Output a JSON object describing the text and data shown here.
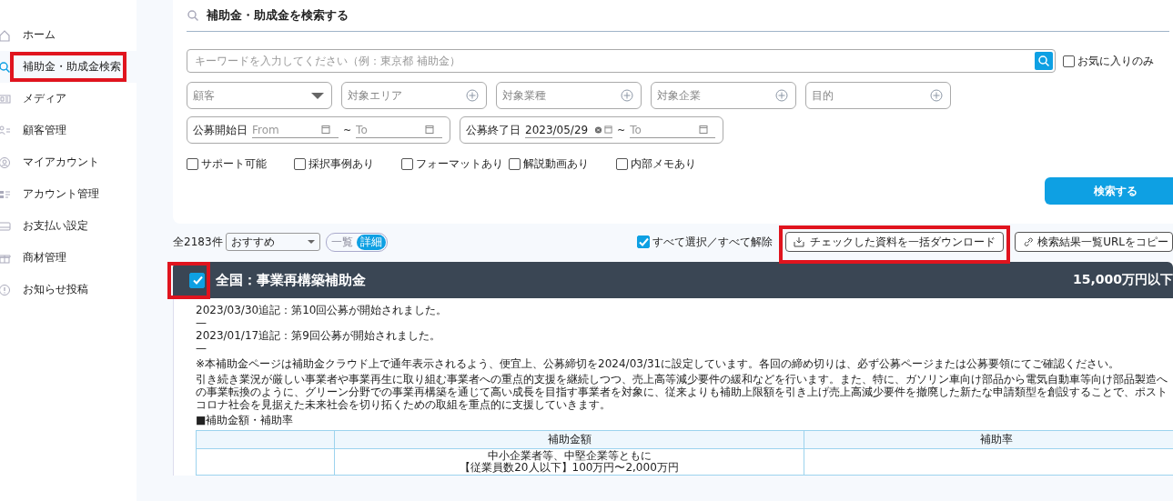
{
  "sidebar": {
    "items": [
      {
        "label": "ホーム",
        "selected": false
      },
      {
        "label": "補助金・助成金検索",
        "selected": true
      },
      {
        "label": "メディア",
        "selected": false
      },
      {
        "label": "顧客管理",
        "selected": false
      },
      {
        "label": "マイアカウント",
        "selected": false
      },
      {
        "label": "アカウント管理",
        "selected": false
      },
      {
        "label": "お支払い設定",
        "selected": false
      },
      {
        "label": "商材管理",
        "selected": false
      },
      {
        "label": "お知らせ投稿",
        "selected": false
      }
    ]
  },
  "search_panel": {
    "title": "補助金・助成金を検索する",
    "keyword": {
      "placeholder": "キーワードを入力してください（例：東京都 補助金）"
    },
    "favorites_only": {
      "label": "お気に入りのみ",
      "checked": false
    },
    "filters": [
      {
        "kind": "dropdown",
        "placeholder": "顧客"
      },
      {
        "kind": "multi",
        "placeholder": "対象エリア"
      },
      {
        "kind": "multi",
        "placeholder": "対象業種"
      },
      {
        "kind": "multi",
        "placeholder": "対象企業"
      },
      {
        "kind": "multi",
        "placeholder": "目的"
      }
    ],
    "date_ranges": [
      {
        "label": "公募開始日",
        "from": {
          "placeholder": "From"
        },
        "separator": "~",
        "to": {
          "placeholder": "To"
        }
      },
      {
        "label": "公募終了日",
        "from": {
          "value": "2023/05/29"
        },
        "separator": "~",
        "to": {
          "placeholder": "To"
        }
      }
    ],
    "options": [
      {
        "label": "サポート可能",
        "checked": false
      },
      {
        "label": "採択事例あり",
        "checked": false
      },
      {
        "label": "フォーマットあり",
        "checked": false
      },
      {
        "label": "解説動画あり",
        "checked": false
      },
      {
        "label": "内部メモあり",
        "checked": false
      }
    ],
    "search_button": "検索する"
  },
  "results": {
    "count": "全2183件",
    "sort": {
      "value": "おすすめ"
    },
    "view_toggle": [
      {
        "label": "一覧",
        "selected": false
      },
      {
        "label": "詳細",
        "selected": true
      }
    ],
    "select_all": {
      "label": "すべて選択／すべて解除",
      "checked": true
    },
    "buttons": [
      {
        "kind": "download",
        "label": "チェックした資料を一括ダウンロード"
      },
      {
        "kind": "link",
        "label": "検索結果一覧URLをコピー"
      }
    ]
  },
  "cards": [
    {
      "checked": true,
      "title": "全国：事業再構築補助金",
      "amount": "15,000万円以下",
      "body": [
        {
          "kind": "line",
          "text": "2023/03/30追記：第10回公募が開始されました。"
        },
        {
          "kind": "line",
          "text": "—"
        },
        {
          "kind": "line",
          "text": "2023/01/17追記：第9回公募が開始されました。"
        },
        {
          "kind": "line",
          "text": "—"
        },
        {
          "kind": "paragraph",
          "text": "※本補助金ページは補助金クラウド上で通年表示されるよう、便宜上、公募締切を2024/03/31に設定しています。各回の締め切りは、必ず公募ページまたは公募要領にてご確認ください。"
        },
        {
          "kind": "paragraph",
          "text": "引き続き業況が厳しい事業者や事業再生に取り組む事業者への重点的支援を継続しつつ、売上高等減少要件の緩和などを行います。また、特に、ガソリン車向け部品から電気自動車等向け部品製造への事業転換のように、グリーン分野での事業再構築を通じて高い成長を目指す事業者を対象に、従来よりも補助上限額を引き上げ売上高減少要件を撤廃した新たな申請類型を創設することで、ポストコロナ社会を見据えた未来社会を切り拓くための取組を重点的に支援していきます。"
        },
        {
          "kind": "paragraph",
          "text": "■補助金額・補助率"
        }
      ],
      "table": {
        "columns": [
          "補助金額",
          "補助率"
        ],
        "rows": [
          {
            "amount_lines": [
              "中小企業者等、中堅企業等ともに",
              "【従業員数20人以下】100万円〜2,000万円"
            ]
          }
        ]
      }
    }
  ]
}
